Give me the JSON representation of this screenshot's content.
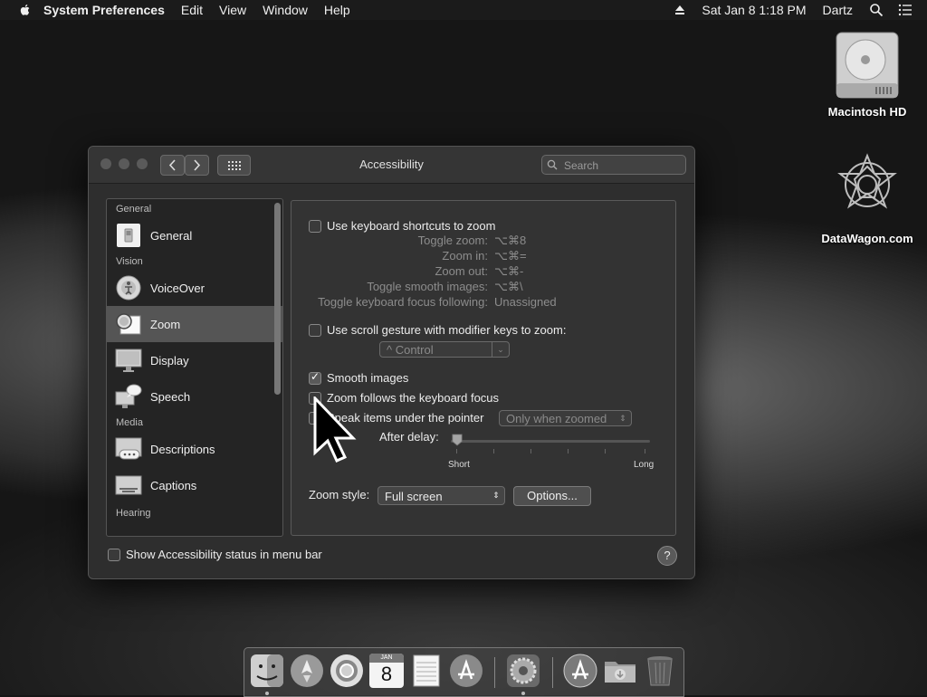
{
  "menubar": {
    "app_name": "System Preferences",
    "items": [
      "Edit",
      "View",
      "Window",
      "Help"
    ],
    "clock": "Sat Jan 8  1:18 PM",
    "user": "Dartz"
  },
  "desktop": {
    "icons": [
      {
        "label": "Macintosh HD",
        "icon": "hard-drive-icon"
      },
      {
        "label": "DataWagon.com",
        "icon": "ornament-icon"
      }
    ]
  },
  "window": {
    "title": "Accessibility",
    "search": {
      "placeholder": "Search"
    }
  },
  "sidebar": {
    "sections": [
      {
        "title": "General",
        "items": [
          {
            "label": "General",
            "icon": "general-switch-icon"
          }
        ]
      },
      {
        "title": "Vision",
        "items": [
          {
            "label": "VoiceOver",
            "icon": "voiceover-icon"
          },
          {
            "label": "Zoom",
            "icon": "zoom-icon",
            "selected": true
          },
          {
            "label": "Display",
            "icon": "display-icon"
          },
          {
            "label": "Speech",
            "icon": "speech-icon"
          }
        ]
      },
      {
        "title": "Media",
        "items": [
          {
            "label": "Descriptions",
            "icon": "descriptions-icon"
          },
          {
            "label": "Captions",
            "icon": "captions-icon"
          }
        ]
      },
      {
        "title": "Hearing",
        "items": []
      }
    ]
  },
  "zoom": {
    "keyboard_shortcuts": {
      "label": "Use keyboard shortcuts to zoom",
      "checked": false
    },
    "shortcuts": [
      {
        "label": "Toggle zoom:",
        "value": "⌥⌘8"
      },
      {
        "label": "Zoom in:",
        "value": "⌥⌘="
      },
      {
        "label": "Zoom out:",
        "value": "⌥⌘-"
      },
      {
        "label": "Toggle smooth images:",
        "value": "⌥⌘\\"
      },
      {
        "label": "Toggle keyboard focus following:",
        "value": "Unassigned"
      }
    ],
    "scroll_gesture": {
      "label": "Use scroll gesture with modifier keys to zoom:",
      "checked": false
    },
    "modifier_popup": "^ Control",
    "smooth_images": {
      "label": "Smooth images",
      "checked": true
    },
    "follow_focus": {
      "label": "Zoom follows the keyboard focus",
      "checked": false
    },
    "speak_items": {
      "label": "Speak items under the pointer",
      "checked": false
    },
    "speak_popup": "Only when zoomed",
    "after_delay": {
      "label": "After delay:",
      "min_label": "Short",
      "max_label": "Long",
      "value_fraction": 0.0
    },
    "zoom_style": {
      "label": "Zoom style:",
      "value": "Full screen"
    },
    "options_button": "Options..."
  },
  "footer": {
    "status_checkbox": {
      "label": "Show Accessibility status in menu bar",
      "checked": false
    },
    "help_button": "?"
  },
  "dock": {
    "apps": [
      "finder-icon",
      "launchpad-icon",
      "chrome-icon",
      "calendar-icon",
      "notes-icon",
      "app-store-icon",
      "system-preferences-icon",
      "app-store-icon",
      "downloads-folder-icon",
      "trash-icon"
    ],
    "calendar_month": "JAN",
    "calendar_day": "8"
  }
}
